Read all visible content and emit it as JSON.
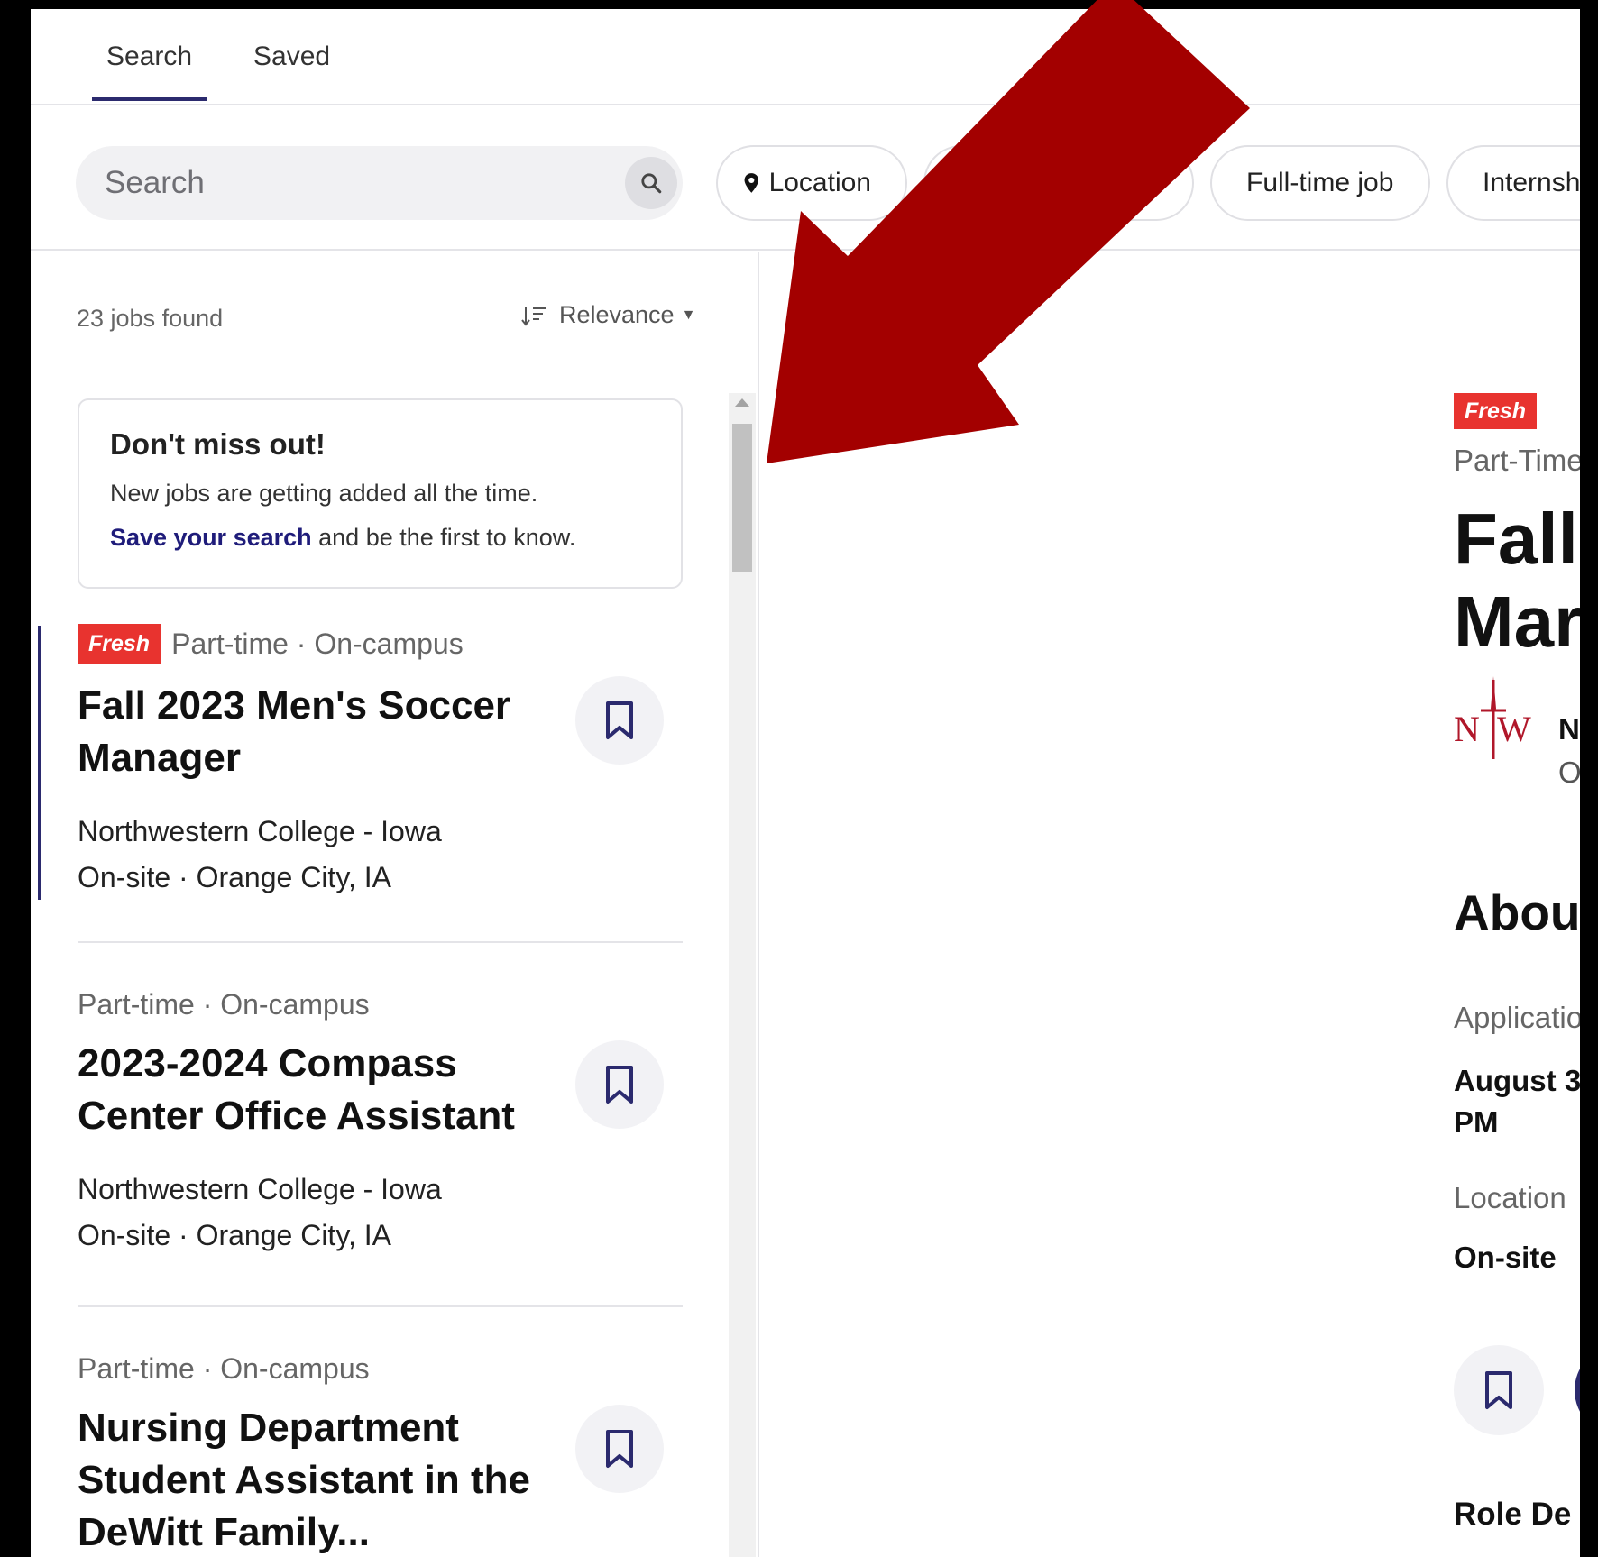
{
  "tabs": {
    "search": "Search",
    "saved": "Saved"
  },
  "search": {
    "placeholder": "Search"
  },
  "filters": {
    "location": "Location",
    "full_time": "Full-time job",
    "internship": "Internsh"
  },
  "results": {
    "count_text": "23 jobs found",
    "sort_label": "Relevance"
  },
  "promo": {
    "title": "Don't miss out!",
    "text": "New jobs are getting added all the time.",
    "link": "Save your search",
    "link_suffix": " and be the first to know."
  },
  "jobs": [
    {
      "badge": "Fresh",
      "meta": "Part-time · On-campus",
      "title": "Fall 2023 Men's Soccer Manager",
      "company": "Northwestern College - Iowa",
      "location": "On-site · Orange City, IA"
    },
    {
      "meta": "Part-time · On-campus",
      "title": "2023-2024 Compass Center Office Assistant",
      "company": "Northwestern College - Iowa",
      "location": "On-site · Orange City, IA"
    },
    {
      "meta": "Part-time · On-campus",
      "title": "Nursing Department Student Assistant in the DeWitt Family..."
    }
  ],
  "detail": {
    "badge": "Fresh",
    "meta": "Part-Time",
    "title_line1": "Fall",
    "title_line2": "Mar",
    "org_line1": "N",
    "org_line2": "O",
    "about": "Abou",
    "application_label": "Applicatio",
    "application_value_line1": "August 3",
    "application_value_line2": "PM",
    "location_label": "Location",
    "location_value": "On-site",
    "role_heading": "Role De"
  },
  "colors": {
    "accent": "#2b2a6e",
    "fresh_badge": "#e8332f",
    "annotation_arrow": "#a30000",
    "logo_red": "#b0172a"
  },
  "icons": {
    "search": "search-icon",
    "location": "map-pin-icon",
    "sort": "sort-icon",
    "bookmark": "bookmark-icon",
    "arrow": "annotation-arrow"
  }
}
